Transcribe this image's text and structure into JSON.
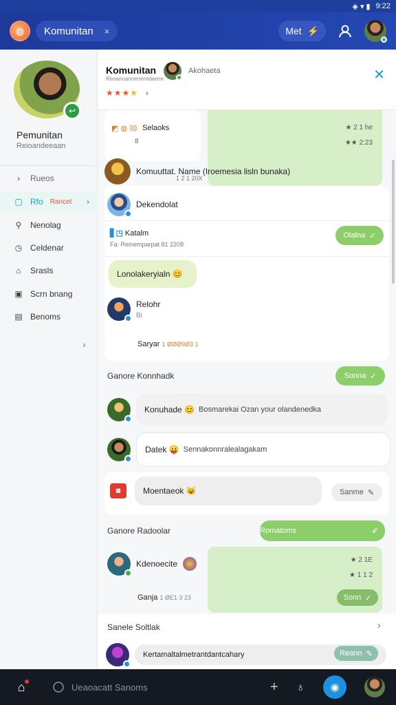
{
  "status": {
    "time": "9:22",
    "icons": "◈ ▾ ▮"
  },
  "appbar": {
    "title": "Komunitan",
    "close": "×",
    "right_pill": "Met",
    "right_pill_icon": "⚡"
  },
  "sidebar": {
    "name": "Pemunitan",
    "subtitle": "Reioandeeaan",
    "items": [
      {
        "icon": "›",
        "label": "Rueos"
      },
      {
        "icon": "▢",
        "label": "Rfo",
        "extra": "Rancet"
      },
      {
        "icon": "⚲",
        "label": "Nenolag"
      },
      {
        "icon": "◷",
        "label": "Celdenar"
      },
      {
        "icon": "⌂",
        "label": "Srasls"
      },
      {
        "icon": "▣",
        "label": "Scrn bnang"
      },
      {
        "icon": "▤",
        "label": "Benoms"
      }
    ]
  },
  "header": {
    "title": "Komunitan",
    "subtitle": "Reoanoanoeneredaene",
    "user": "Akohaeta",
    "stars": "★★★",
    "star_half": "★",
    "rating_icon": "◑",
    "close": "✕"
  },
  "feed": {
    "item1": {
      "label": "Selaoks",
      "icons": "◩ ◍ ⑽",
      "num": "8",
      "r1": "★ 2 1 he",
      "r2": "★★ 2:23"
    },
    "item2": {
      "text": "Komuuttat. Name (Iroemesia lisln bunaka)",
      "meta": "1 2 1 20X"
    },
    "item3": {
      "text": "Dekendolat"
    },
    "item4": {
      "label": "Katalm",
      "icons": "▋◳",
      "meta": "Fa: Reinemparpat 81 2208",
      "button": "Olalna"
    },
    "item5": {
      "bubble": "Lonolakeryialn 😊"
    },
    "item6": {
      "title": "Relohr",
      "sub": "Bi",
      "foot": "Saryar",
      "foot_meta": "1 ØØØ9Ø3 1"
    },
    "section1": {
      "title": "Ganore Konnhadk",
      "button": "Sonna"
    },
    "msg1": {
      "name": "Konuhade 😊",
      "text": "Bosmarekai Ozan your olandenedka"
    },
    "msg2": {
      "name": "Datek 😛",
      "text": "Sennakonnralealagakam"
    },
    "msg3": {
      "name": "Moentaeok 😺",
      "button": "Sanme"
    },
    "section2": {
      "title": "Ganore Radoolar",
      "button": "Romatoms"
    },
    "item7": {
      "name": "Kdenoecite",
      "r1": "★ 2 1E",
      "r2": "★ 1 1 2",
      "foot": "Ganja",
      "foot_meta": "1 ØE1 3 23",
      "button": "Sonn"
    },
    "section3": {
      "title": "Sanele Soltlak",
      "chevron": "›"
    },
    "item8": {
      "text": "Kertamaltalmetrantdantcahary",
      "button": "Reann"
    }
  },
  "bottombar": {
    "search": "Ueaoacatt Sanoms",
    "home_icon": "⌂",
    "plus": "+",
    "bulb": "♁",
    "cam": "◉"
  }
}
